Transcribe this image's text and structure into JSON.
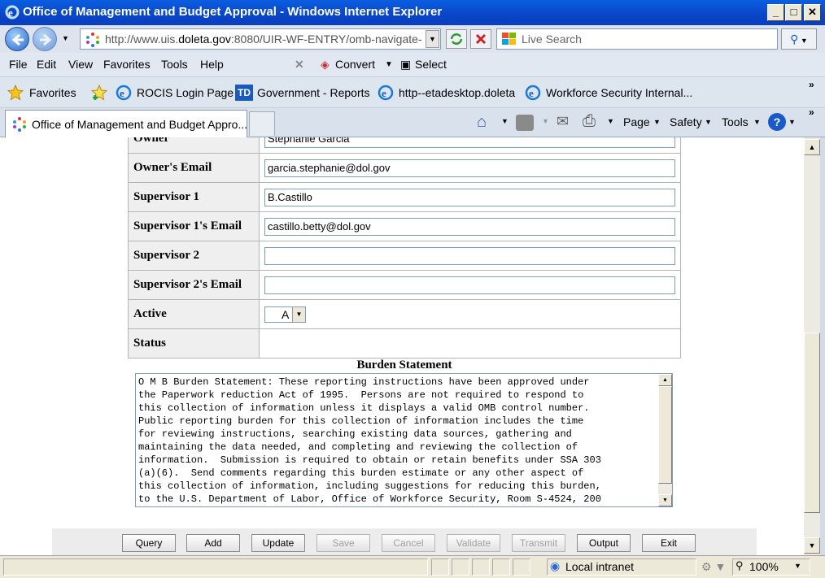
{
  "window": {
    "title": "Office of Management and Budget Approval - Windows Internet Explorer"
  },
  "address_bar": {
    "url_prefix": "http://www.uis.",
    "url_domain": "doleta.gov",
    "url_suffix": ":8080/UIR-WF-ENTRY/omb-navigate-",
    "search_placeholder": "Live Search"
  },
  "menu": {
    "items": [
      "File",
      "Edit",
      "View",
      "Favorites",
      "Tools",
      "Help"
    ],
    "convert_label": "Convert",
    "select_label": "Select"
  },
  "favorites_bar": {
    "favorites_label": "Favorites",
    "items": [
      "ROCIS Login Page",
      "Government - Reports",
      "http--etadesktop.doleta",
      "Workforce Security Internal..."
    ]
  },
  "tab": {
    "label": "Office of Management and Budget Appro..."
  },
  "command_bar": {
    "page_label": "Page",
    "safety_label": "Safety",
    "tools_label": "Tools"
  },
  "form": {
    "owner_label": "Owner",
    "owner_value": "Stephanie Garcia",
    "owner_email_label": "Owner's Email",
    "owner_email_value": "garcia.stephanie@dol.gov",
    "supervisor1_label": "Supervisor 1",
    "supervisor1_value": "B.Castillo",
    "supervisor1_email_label": "Supervisor 1's Email",
    "supervisor1_email_value": "castillo.betty@dol.gov",
    "supervisor2_label": "Supervisor 2",
    "supervisor2_value": "",
    "supervisor2_email_label": "Supervisor 2's Email",
    "supervisor2_email_value": "",
    "active_label": "Active",
    "active_value": "A",
    "status_label": "Status",
    "status_value": ""
  },
  "burden": {
    "title": "Burden Statement",
    "text": "O M B Burden Statement: These reporting instructions have been approved under\nthe Paperwork reduction Act of 1995.  Persons are not required to respond to\nthis collection of information unless it displays a valid OMB control number.\nPublic reporting burden for this collection of information includes the time\nfor reviewing instructions, searching existing data sources, gathering and\nmaintaining the data needed, and completing and reviewing the collection of\ninformation.  Submission is required to obtain or retain benefits under SSA 303\n(a)(6).  Send comments regarding this burden estimate or any other aspect of\nthis collection of information, including suggestions for reducing this burden,\nto the U.S. Department of Labor, Office of Workforce Security, Room S-4524, 200"
  },
  "buttons": {
    "query": "Query",
    "add": "Add",
    "update": "Update",
    "save": "Save",
    "cancel": "Cancel",
    "validate": "Validate",
    "transmit": "Transmit",
    "output": "Output",
    "exit": "Exit"
  },
  "status_bar": {
    "zone": "Local intranet",
    "zoom": "100%"
  },
  "colors": {
    "titlebar": "#0a45c8",
    "label_bg": "#efefef"
  }
}
